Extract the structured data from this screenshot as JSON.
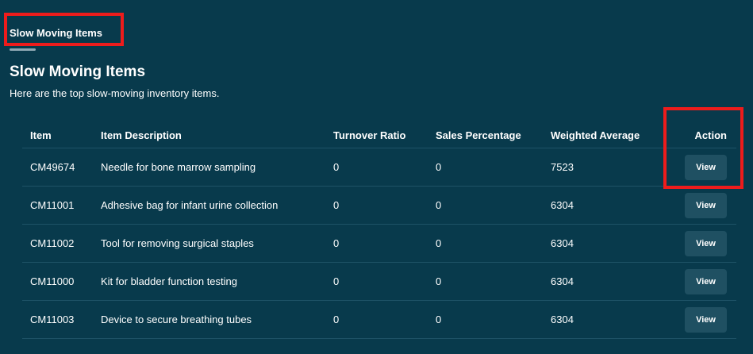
{
  "tab": {
    "label": "Slow Moving Items"
  },
  "page": {
    "title": "Slow Moving Items",
    "subtitle": "Here are the top slow-moving inventory items."
  },
  "table": {
    "headers": {
      "item": "Item",
      "description": "Item Description",
      "turnover": "Turnover Ratio",
      "sales": "Sales Percentage",
      "weighted": "Weighted Average",
      "action": "Action"
    },
    "rows": [
      {
        "item": "CM49674",
        "description": "Needle for bone marrow sampling",
        "turnover": "0",
        "sales": "0",
        "weighted": "7523",
        "action_label": "View"
      },
      {
        "item": "CM11001",
        "description": "Adhesive bag for infant urine collection",
        "turnover": "0",
        "sales": "0",
        "weighted": "6304",
        "action_label": "View"
      },
      {
        "item": "CM11002",
        "description": "Tool for removing surgical staples",
        "turnover": "0",
        "sales": "0",
        "weighted": "6304",
        "action_label": "View"
      },
      {
        "item": "CM11000",
        "description": "Kit for bladder function testing",
        "turnover": "0",
        "sales": "0",
        "weighted": "6304",
        "action_label": "View"
      },
      {
        "item": "CM11003",
        "description": "Device to secure breathing tubes",
        "turnover": "0",
        "sales": "0",
        "weighted": "6304",
        "action_label": "View"
      }
    ]
  },
  "colors": {
    "background": "#083a4c",
    "button": "#1f5062",
    "highlight": "#ee1c1c",
    "row_divider": "#1e5266"
  }
}
